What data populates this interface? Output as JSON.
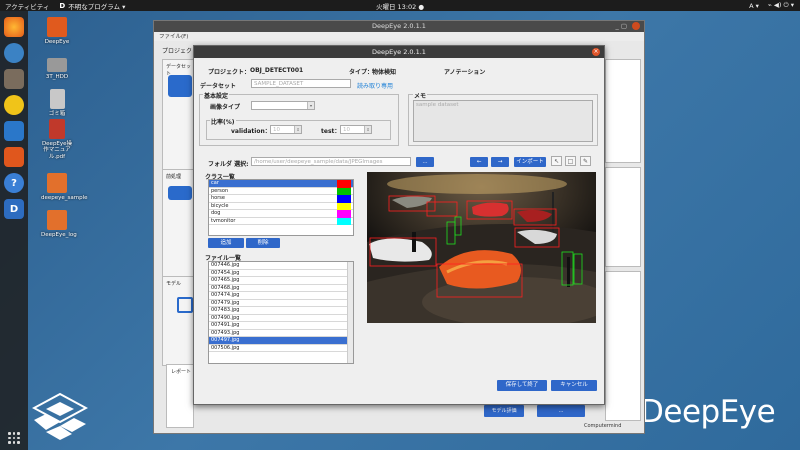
{
  "topbar": {
    "activities": "アクティビティ",
    "app_letter": "D",
    "app_name": "不明なプログラム ▾",
    "clock": "火曜日 13:02 ●",
    "lang": "A ▾",
    "tray": "⌁ ◀) ⏻ ▾"
  },
  "desktop": {
    "icons": [
      {
        "label": "DeepEye"
      },
      {
        "label": "3T_HDD"
      },
      {
        "label": "ゴミ箱"
      },
      {
        "label": "DeepEye操作マニュアル.pdf"
      },
      {
        "label": "deepeye_sample"
      },
      {
        "label": "DeepEye_log"
      }
    ],
    "brand": "DeepEye"
  },
  "back_window": {
    "title": "DeepEye 2.0.1.1",
    "menu": "ファイル(F)",
    "project_label": "プロジェクト",
    "dataset_label": "データセット",
    "preprocess_label": "前処理",
    "model_label": "モデル",
    "report_label": "レポート",
    "eval_btn": "モデル評価",
    "infer_btn": "...",
    "footer": "Computermind"
  },
  "dialog": {
    "title": "DeepEye 2.0.1.1",
    "project_label": "プロジェクト：",
    "project_name": "OBJ_DETECT001",
    "type_label": "タイプ：",
    "type_value": "物体検知",
    "annotation_label": "アノテーション",
    "dataset_label": "データセット",
    "dataset_value": "SAMPLE_DATASET",
    "readonly": "読み取り専用",
    "basic_label": "基本設定",
    "image_type_label": "画像タイプ",
    "image_type_value": "",
    "ratio_label": "比率(%)",
    "val_label": "validation：",
    "val_value": "10",
    "test_label": "test：",
    "test_value": "10",
    "memo_label": "メモ",
    "memo_value": "sample dataset",
    "folder_label": "フォルダ 選択:",
    "folder_path": "/home/user/deepeye_sample/data/JPEGImages",
    "browse": "...",
    "prev": "←",
    "next": "→",
    "import": "インポート",
    "class_label": "クラス一覧",
    "classes": [
      {
        "name": "car",
        "color": "#ff0000"
      },
      {
        "name": "person",
        "color": "#00c000"
      },
      {
        "name": "horse",
        "color": "#0000ff"
      },
      {
        "name": "bicycle",
        "color": "#ffff00"
      },
      {
        "name": "dog",
        "color": "#ff00ff"
      },
      {
        "name": "tvmonitor",
        "color": "#00ffff"
      }
    ],
    "add": "追加",
    "remove": "削除",
    "file_label": "ファイル一覧",
    "files": [
      "007446.jpg",
      "007454.jpg",
      "007465.jpg",
      "007468.jpg",
      "007474.jpg",
      "007479.jpg",
      "007483.jpg",
      "007490.jpg",
      "007491.jpg",
      "007493.jpg",
      "007497.jpg",
      "007506.jpg"
    ],
    "selected_file": "007497.jpg",
    "save": "保存して終了",
    "cancel": "キャンセル"
  }
}
